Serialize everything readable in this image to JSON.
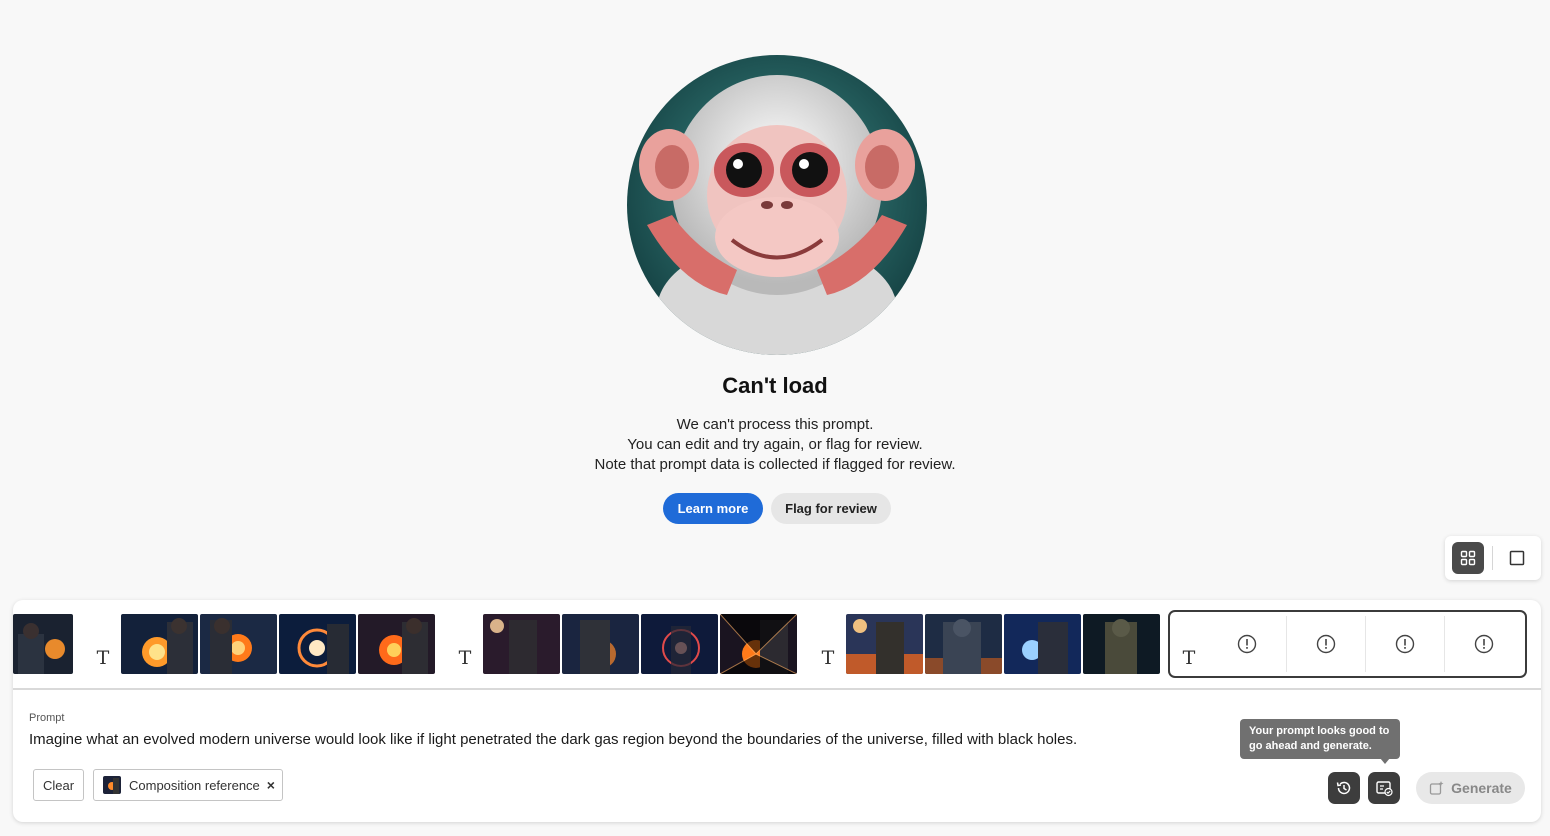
{
  "error": {
    "title": "Can't load",
    "line1": "We can't process this prompt.",
    "line2": "You can edit and try again, or flag for review.",
    "line3": "Note that prompt data is collected if flagged for review.",
    "learn_more": "Learn more",
    "flag_for_review": "Flag for review"
  },
  "view_toggle": {
    "grid_icon": "grid-view-icon",
    "single_icon": "single-view-icon"
  },
  "history": {
    "text_badge": "T",
    "groups": [
      {
        "thumbs": [
          "cosmic-man-orb",
          "cosmic-man-orb",
          "cosmic-man-ring",
          "cosmic-man-orb"
        ]
      },
      {
        "thumbs": [
          "cosmic-man-moon",
          "cosmic-man-gears",
          "cosmic-man-ring",
          "cosmic-man-burst"
        ]
      },
      {
        "thumbs": [
          "cosmic-man-desert",
          "cosmic-man-armor",
          "cosmic-man-orb",
          "cosmic-man-space"
        ]
      }
    ],
    "failed_group": {
      "icon": "alert-circle-icon",
      "count": 4
    }
  },
  "prompt": {
    "label": "Prompt",
    "text": "Imagine what an evolved modern universe would look like if light penetrated the dark gas region beyond the boundaries of the universe, filled with black holes."
  },
  "actions": {
    "clear": "Clear",
    "composition_reference": "Composition reference",
    "remove_icon": "×",
    "tooltip_line1": "Your prompt looks good to",
    "tooltip_line2": "go ahead and generate.",
    "generate": "Generate"
  },
  "colors": {
    "primary": "#1f6bd8",
    "dark_button": "#3d3d3d",
    "tooltip": "#707070"
  }
}
